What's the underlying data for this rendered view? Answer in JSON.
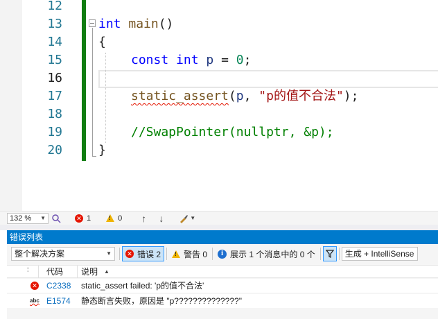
{
  "editor": {
    "line_numbers": [
      "12",
      "13",
      "14",
      "15",
      "16",
      "17",
      "18",
      "19",
      "20"
    ],
    "lines": {
      "l13": {
        "kw": "int",
        "fn": "main",
        "rest": "()"
      },
      "l14": "{",
      "l15": {
        "kw1": "const",
        "kw2": "int",
        "var": "p",
        "op": " = ",
        "num": "0",
        "end": ";"
      },
      "l17": {
        "fn": "static_assert",
        "open": "(",
        "var": "p",
        "sep": ", ",
        "str": "\"p的值不合法\"",
        "end": ");"
      },
      "l19": "//SwapPointer(nullptr, &p);",
      "l20": "}"
    }
  },
  "status_strip": {
    "zoom": "132 %",
    "error_count": "1",
    "warning_count": "0"
  },
  "error_list": {
    "title": "错误列表",
    "scope": "整个解决方案",
    "errors_label": "错误 2",
    "warnings_label": "警告 0",
    "messages_label": "展示 1 个消息中的 0 个",
    "build_filter": "生成 + IntelliSense",
    "columns": {
      "code": "代码",
      "description": "说明"
    },
    "rows": [
      {
        "code": "C2338",
        "description": "static_assert failed: 'p的值不合法'"
      },
      {
        "code": "E1574",
        "description": "静态断言失败，原因是 \"p??????????????\""
      }
    ]
  },
  "colors": {
    "accent": "#007acc",
    "change_bar": "#107c10",
    "error": "#e51400"
  }
}
